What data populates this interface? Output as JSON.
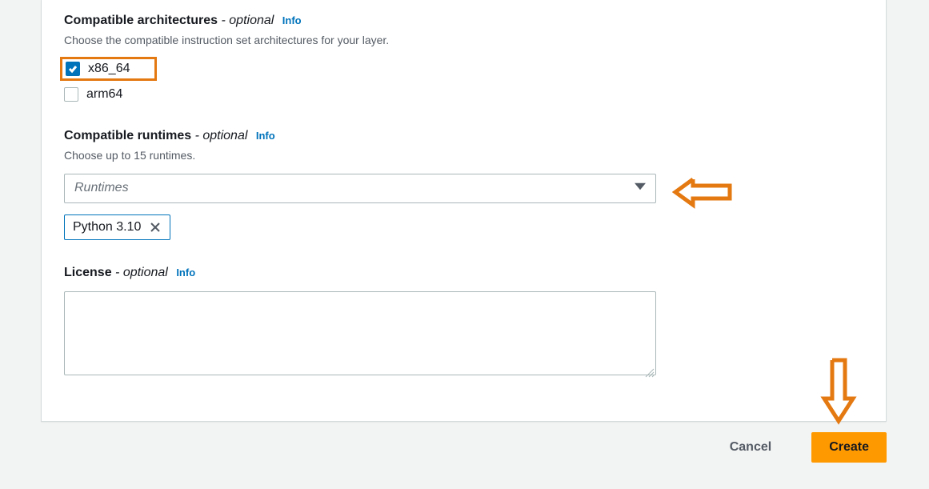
{
  "architectures": {
    "title": "Compatible architectures",
    "optional_suffix": " - optional",
    "info": "Info",
    "description": "Choose the compatible instruction set architectures for your layer.",
    "options": [
      {
        "label": "x86_64",
        "checked": true,
        "highlighted": true
      },
      {
        "label": "arm64",
        "checked": false,
        "highlighted": false
      }
    ]
  },
  "runtimes": {
    "title": "Compatible runtimes",
    "optional_suffix": " - optional",
    "info": "Info",
    "description": "Choose up to 15 runtimes.",
    "dropdown_placeholder": "Runtimes",
    "selected": [
      {
        "label": "Python 3.10"
      }
    ]
  },
  "license": {
    "title": "License",
    "optional_suffix": " - optional",
    "info": "Info",
    "value": ""
  },
  "buttons": {
    "cancel": "Cancel",
    "create": "Create"
  },
  "annotations": {
    "arrow_color": "#e47911"
  }
}
